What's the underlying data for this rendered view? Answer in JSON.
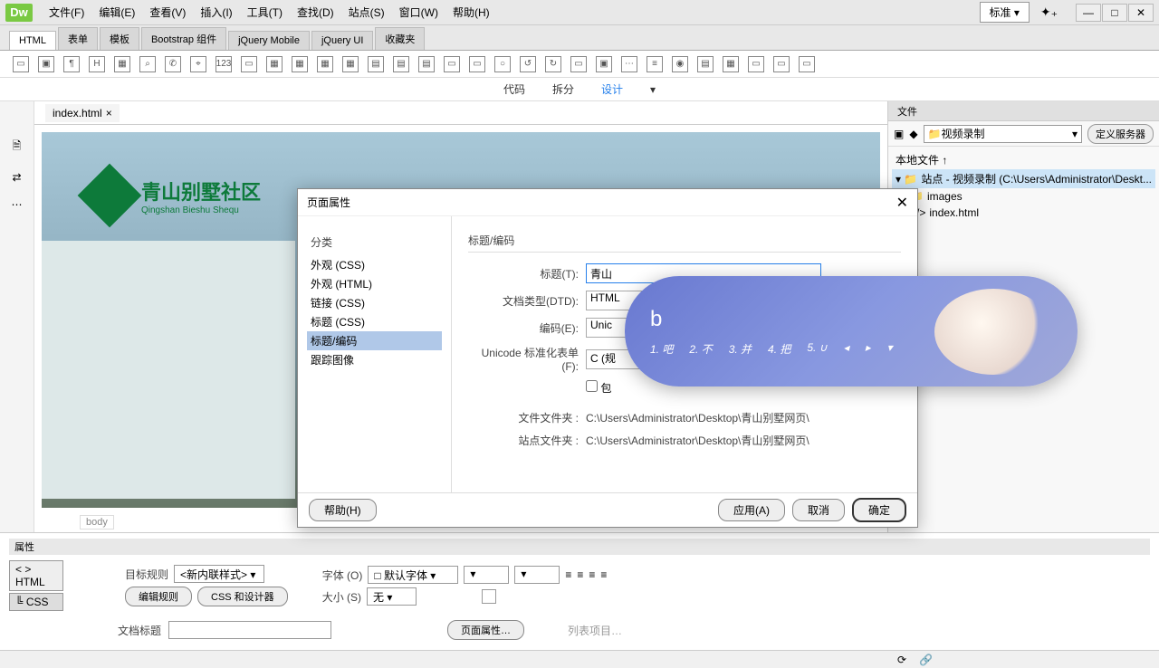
{
  "menubar": {
    "items": [
      "文件(F)",
      "编辑(E)",
      "查看(V)",
      "插入(I)",
      "工具(T)",
      "查找(D)",
      "站点(S)",
      "窗口(W)",
      "帮助(H)"
    ],
    "layout_dropdown": "标准"
  },
  "tabs": [
    "HTML",
    "表单",
    "模板",
    "Bootstrap 组件",
    "jQuery Mobile",
    "jQuery UI",
    "收藏夹"
  ],
  "view_modes": {
    "code": "代码",
    "split": "拆分",
    "design": "设计"
  },
  "doc_tab": "index.html",
  "site_logo": {
    "cn": "青山别墅社区",
    "en": "Qingshan Bieshu Shequ"
  },
  "files_panel": {
    "title": "文件",
    "site_select": "视频录制",
    "define_server": "定义服务器",
    "header": "本地文件 ↑",
    "root": "站点 - 视频录制 (C:\\Users\\Administrator\\Deskt...",
    "folder": "images",
    "file": "index.html"
  },
  "properties": {
    "title": "属性",
    "html_mode": "HTML",
    "css_mode": "CSS",
    "target_rule_label": "目标规则",
    "target_rule_value": "<新内联样式>",
    "edit_rule": "编辑规则",
    "css_designer": "CSS 和设计器",
    "font_label": "字体 (O)",
    "font_value": "默认字体",
    "size_label": "大小 (S)",
    "size_value": "无",
    "doc_title_label": "文档标题",
    "page_props": "页面属性…",
    "list_items": "列表项目…"
  },
  "dialog": {
    "title": "页面属性",
    "category_label": "分类",
    "categories": [
      "外观 (CSS)",
      "外观 (HTML)",
      "链接 (CSS)",
      "标题 (CSS)",
      "标题/编码",
      "跟踪图像"
    ],
    "section": "标题/编码",
    "title_label": "标题(T):",
    "title_value": "青山",
    "dtd_label": "文档类型(DTD):",
    "dtd_value": "HTML",
    "encoding_label": "编码(E):",
    "encoding_value": "Unic",
    "unicode_label": "Unicode 标准化表单 (F):",
    "unicode_value": "C (规",
    "include_label": "包",
    "file_folder_label": "文件文件夹 :",
    "file_folder_value": "C:\\Users\\Administrator\\Desktop\\青山别墅网页\\",
    "site_folder_label": "站点文件夹 :",
    "site_folder_value": "C:\\Users\\Administrator\\Desktop\\青山别墅网页\\",
    "help": "帮助(H)",
    "apply": "应用(A)",
    "cancel": "取消",
    "ok": "确定"
  },
  "ime": {
    "input": "b",
    "candidates": [
      "1. 吧",
      "2. 不",
      "3. 并",
      "4. 把",
      "5. ∪"
    ]
  },
  "body_tag": "body"
}
